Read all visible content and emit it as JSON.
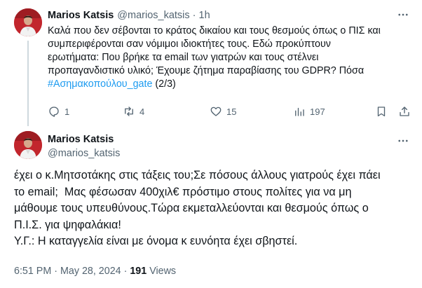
{
  "tweet1": {
    "author_name": "Marios Katsis",
    "handle": "@marios_katsis",
    "separator": "·",
    "time": "1h",
    "text": "Καλά που δεν σέβονται το κράτος δικαίου και τους θεσμούς όπως ο ΠΙΣ και\nσυμπεριφέρονται σαν νόμιμοι ιδιοκτήτες τους. Εδώ προκύπτουν\nερωτήματα: Που βρήκε τα email των γιατρών και τους στέλνει\nπροπαγανδιστικό υλικό; Έχουμε ζήτημα παραβίασης του GDPR? Πόσα\n",
    "hashtag": "#Ασημακοπούλου_gate",
    "suffix": " (2/3)",
    "replies": "1",
    "reposts": "4",
    "likes": "15",
    "views": "197"
  },
  "tweet2": {
    "author_name": "Marios Katsis",
    "handle": "@marios_katsis",
    "text": "έχει ο κ.Μητσοτάκης στις τάξεις του;Σε πόσους άλλους γιατρούς έχει πάει\nτο email;  Μας φέσωσαν 400χιλ€ πρόστιμο στους πολίτες για να μη\nμάθουμε τους υπευθύνους.Τώρα εκμεταλλεύονται και θεσμούς όπως ο\nΠ.Ι.Σ. για ψηφαλάκια!\nΥ.Γ.: Η καταγγελία είναι με όνομα κ ευνόητα έχει σβηστεί.",
    "time": "6:51 PM",
    "separator": "·",
    "date": "May 28, 2024",
    "views_count": "191",
    "views_label": "Views"
  },
  "colors": {
    "text": "#0f1419",
    "muted": "#536471",
    "link": "#1d9bf0",
    "divider": "#cfd9de",
    "avatar_bg": "#c2262d"
  },
  "icons": [
    "more-icon",
    "reply-icon",
    "repost-icon",
    "like-icon",
    "views-icon",
    "bookmark-icon",
    "share-icon"
  ]
}
